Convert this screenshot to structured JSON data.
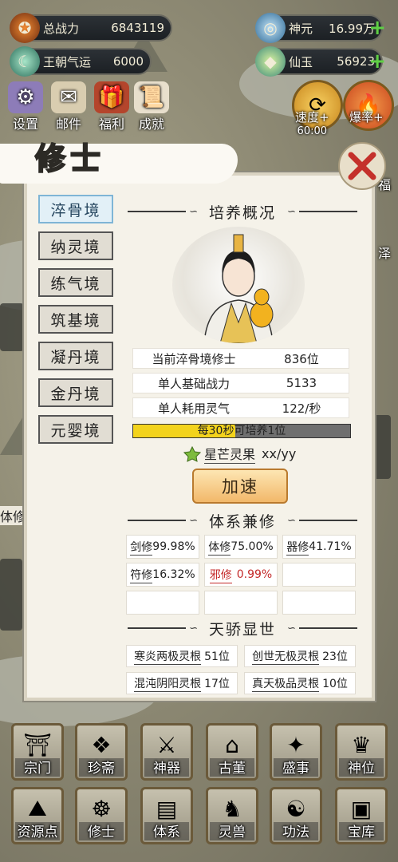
{
  "stats": {
    "power": {
      "label": "总战力",
      "value": "6843119"
    },
    "luck": {
      "label": "王朝气运",
      "value": "6000"
    },
    "shenyuan": {
      "label": "神元",
      "value": "16.99万"
    },
    "xianyu": {
      "label": "仙玉",
      "value": "56923"
    }
  },
  "top_buttons": [
    "设置",
    "邮件",
    "福利",
    "成就"
  ],
  "round_buttons": {
    "speed": {
      "label": "速度+",
      "timer": "60:00"
    },
    "crit": {
      "label": "爆率+"
    }
  },
  "side_labels": {
    "fu": "福",
    "ze": "泽",
    "tixiu_edge": "体修"
  },
  "panel": {
    "title": "修士",
    "tabs": [
      "淬骨境",
      "纳灵境",
      "练气境",
      "筑基境",
      "凝丹境",
      "金丹境",
      "元婴境"
    ],
    "active_tab": 0,
    "section1": "培养概况",
    "info": [
      {
        "k": "当前淬骨境修士",
        "v": "836位"
      },
      {
        "k": "单人基础战力",
        "v": "5133"
      },
      {
        "k": "单人耗用灵气",
        "v": "122/秒"
      }
    ],
    "progress": {
      "text": "每30秒可培养1位",
      "fraction": 0.47
    },
    "fruit": {
      "name": "星芒灵果",
      "amount": "xx/yy"
    },
    "speed_button": "加速",
    "section2": "体系兼修",
    "cultivation": [
      {
        "name": "剑修",
        "value": "99.98%",
        "red": false
      },
      {
        "name": "体修",
        "value": "75.00%",
        "red": false
      },
      {
        "name": "器修",
        "value": "41.71%",
        "red": false
      },
      {
        "name": "符修",
        "value": "16.32%",
        "red": false
      },
      {
        "name": "邪修",
        "value": "0.99%",
        "red": true
      },
      {
        "name": "",
        "value": "",
        "red": false
      },
      {
        "name": "",
        "value": "",
        "red": false
      },
      {
        "name": "",
        "value": "",
        "red": false
      },
      {
        "name": "",
        "value": "",
        "red": false
      }
    ],
    "section3": "天骄显世",
    "talents": [
      {
        "name": "寒炎两极灵根",
        "value": "51位"
      },
      {
        "name": "创世无极灵根",
        "value": "23位"
      },
      {
        "name": "混沌阴阳灵根",
        "value": "17位"
      },
      {
        "name": "真天极品灵根",
        "value": "10位"
      }
    ]
  },
  "bottom_row1": [
    "宗门",
    "珍斋",
    "神器",
    "古董",
    "盛事",
    "神位"
  ],
  "bottom_row2": [
    "资源点",
    "修士",
    "体系",
    "灵兽",
    "功法",
    "宝库"
  ],
  "colors": {
    "accent": "#7fb5d6",
    "progress": "#f3d31c",
    "red": "#c42929",
    "button": "#f2b86a"
  }
}
